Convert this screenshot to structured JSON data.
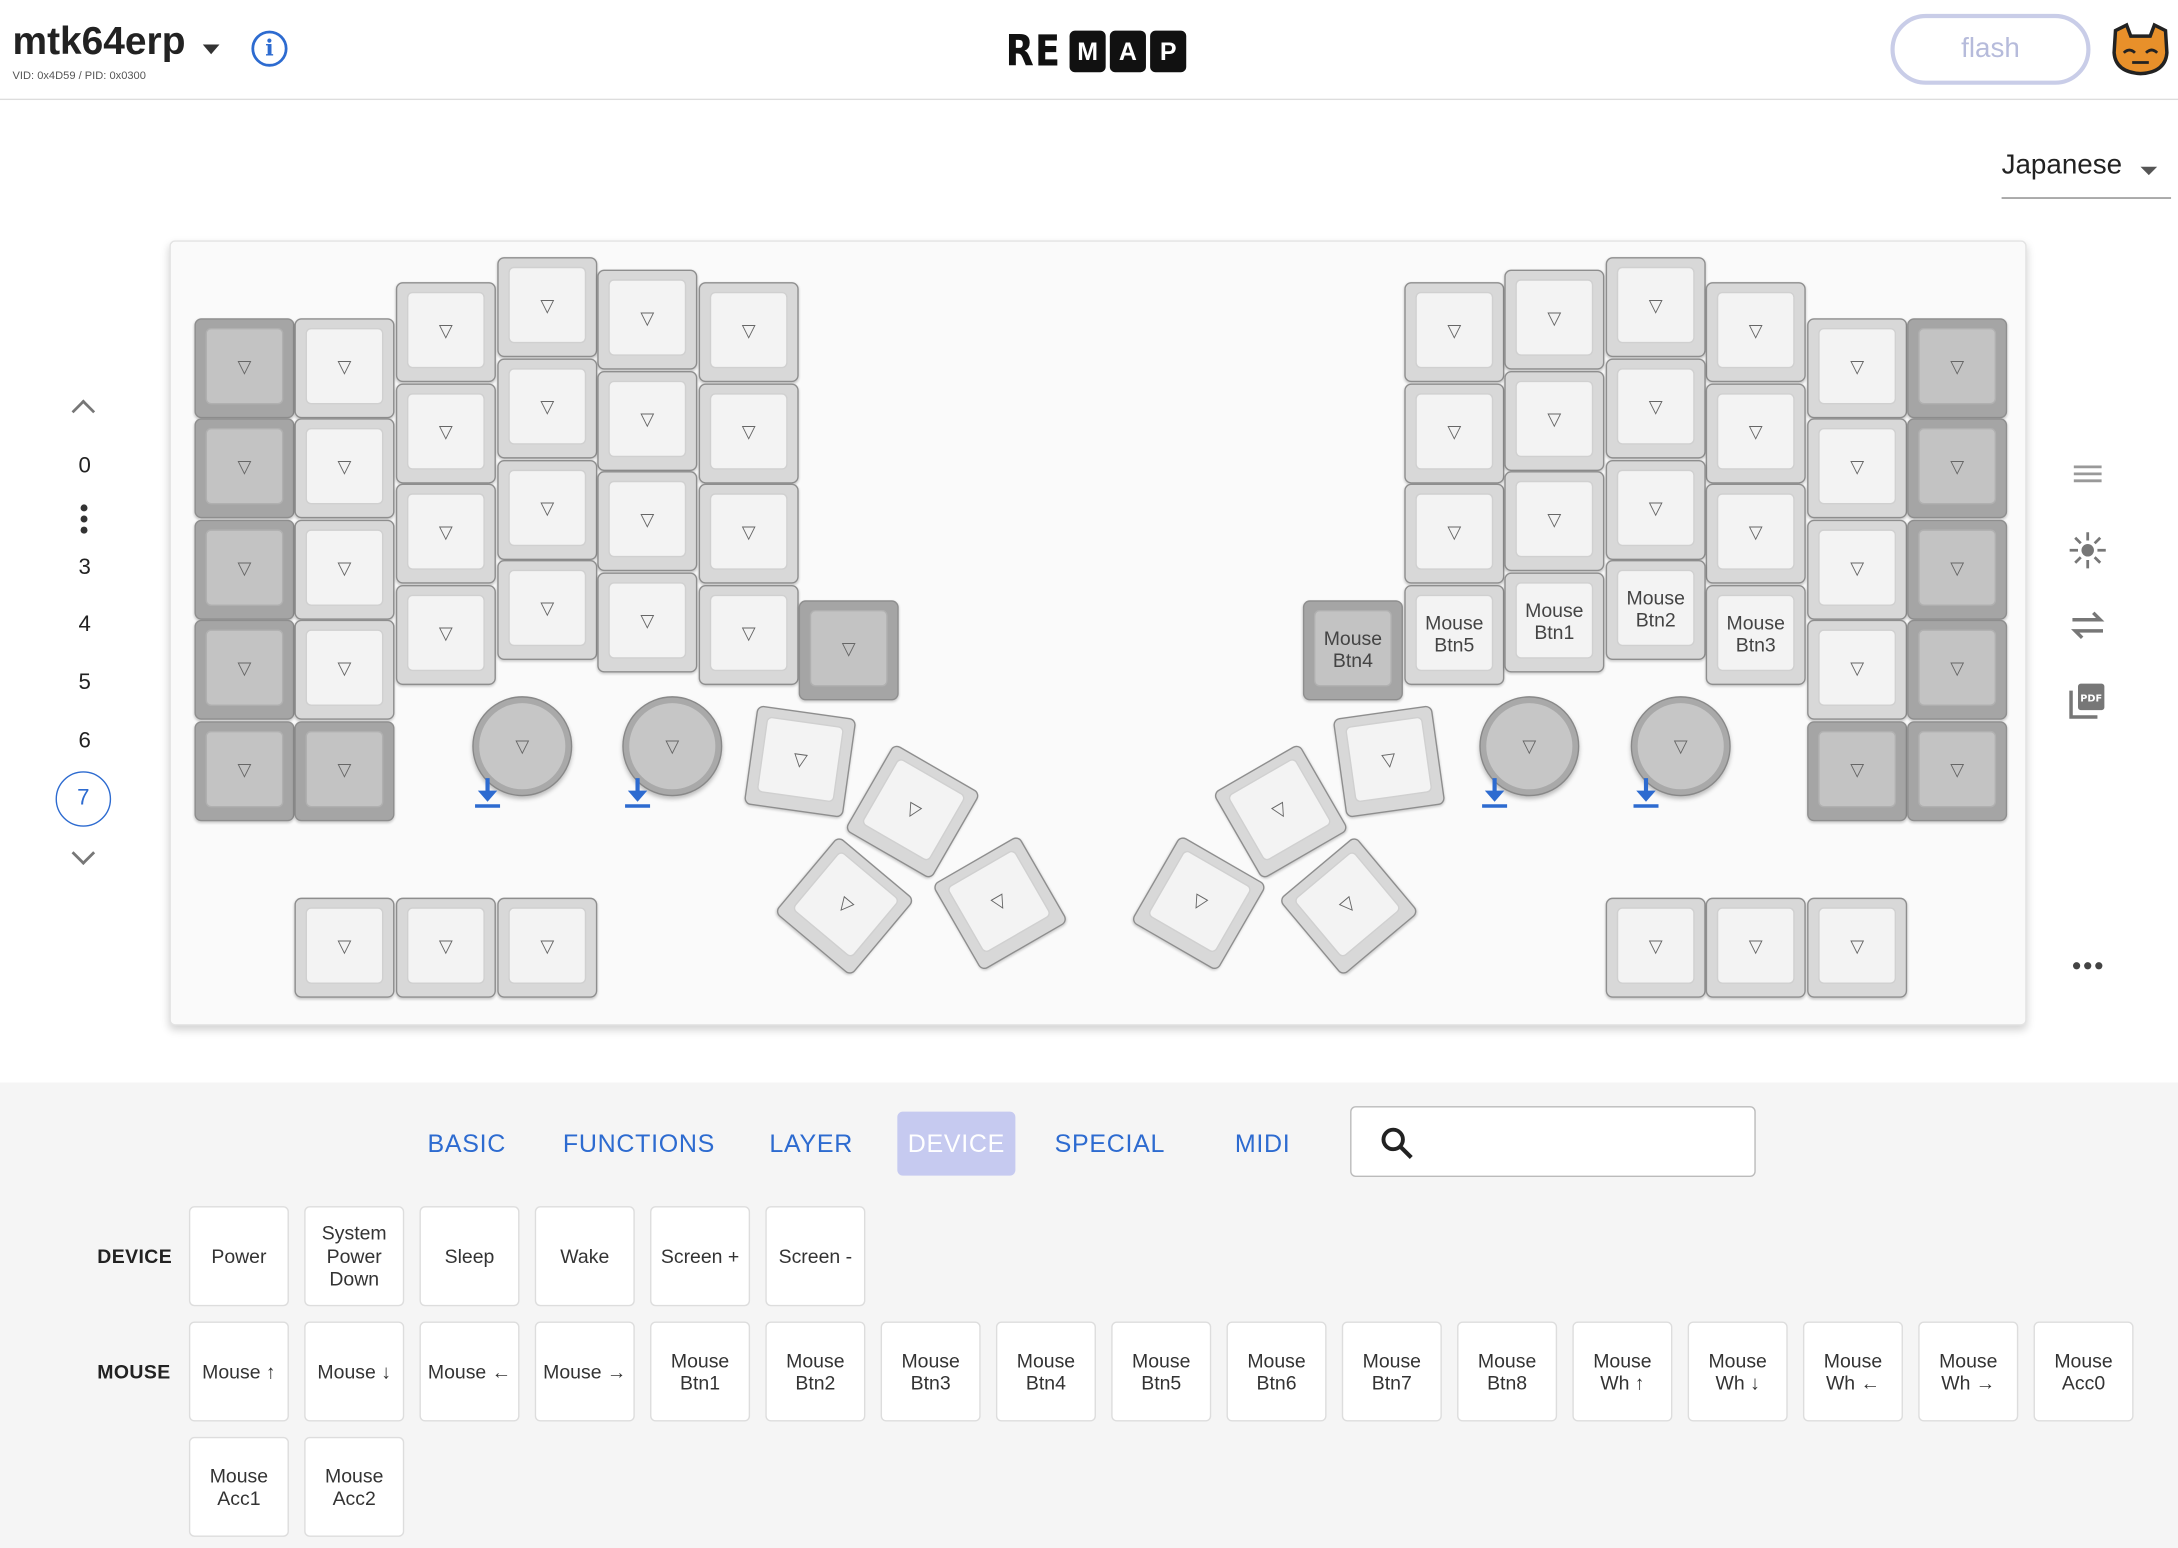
{
  "header": {
    "keyboard_name": "mtk64erp",
    "vid_pid": "VID: 0x4D59 / PID: 0x0300",
    "logo_prefix": "RE",
    "logo_boxes": [
      "M",
      "A",
      "P"
    ],
    "flash_label": "flash"
  },
  "language": {
    "selected": "Japanese"
  },
  "layers": {
    "labels": [
      "0",
      "3",
      "4",
      "5",
      "6",
      "7"
    ],
    "selected": "7"
  },
  "keymap": {
    "empty_glyph": "▽",
    "labels": {
      "mouse_btn4": "Mouse\nBtn4",
      "mouse_btn5": "Mouse\nBtn5",
      "mouse_btn1": "Mouse\nBtn1",
      "mouse_btn2": "Mouse\nBtn2",
      "mouse_btn3": "Mouse\nBtn3"
    }
  },
  "tabs": [
    "BASIC",
    "FUNCTIONS",
    "LAYER",
    "DEVICE",
    "SPECIAL",
    "MIDI"
  ],
  "active_tab": "DEVICE",
  "search": {
    "placeholder": ""
  },
  "categories": {
    "device": {
      "label": "DEVICE",
      "keys": [
        "Power",
        "System\nPower\nDown",
        "Sleep",
        "Wake",
        "Screen +",
        "Screen -"
      ]
    },
    "mouse": {
      "label": "MOUSE",
      "keys": [
        "Mouse ↑",
        "Mouse ↓",
        "Mouse ←",
        "Mouse →",
        "Mouse\nBtn1",
        "Mouse\nBtn2",
        "Mouse\nBtn3",
        "Mouse\nBtn4",
        "Mouse\nBtn5",
        "Mouse\nBtn6",
        "Mouse\nBtn7",
        "Mouse\nBtn8",
        "Mouse\nWh ↑",
        "Mouse\nWh ↓",
        "Mouse\nWh ←",
        "Mouse\nWh →",
        "Mouse\nAcc0",
        "Mouse\nAcc1",
        "Mouse\nAcc2"
      ]
    }
  },
  "colors": {
    "accent": "#2d6bd0",
    "active_tab_bg": "#c6caf0",
    "dark_key": "#a5a5a5",
    "light_key": "#f3f3f3"
  },
  "icons": [
    "chevron-down-icon",
    "info-icon",
    "cat-avatar-icon",
    "chevron-up-icon",
    "more-vert-icon",
    "lines-icon",
    "light-icon",
    "swap-icon",
    "pdf-icon",
    "more-horiz-icon",
    "search-icon",
    "download-arrow-icon"
  ]
}
